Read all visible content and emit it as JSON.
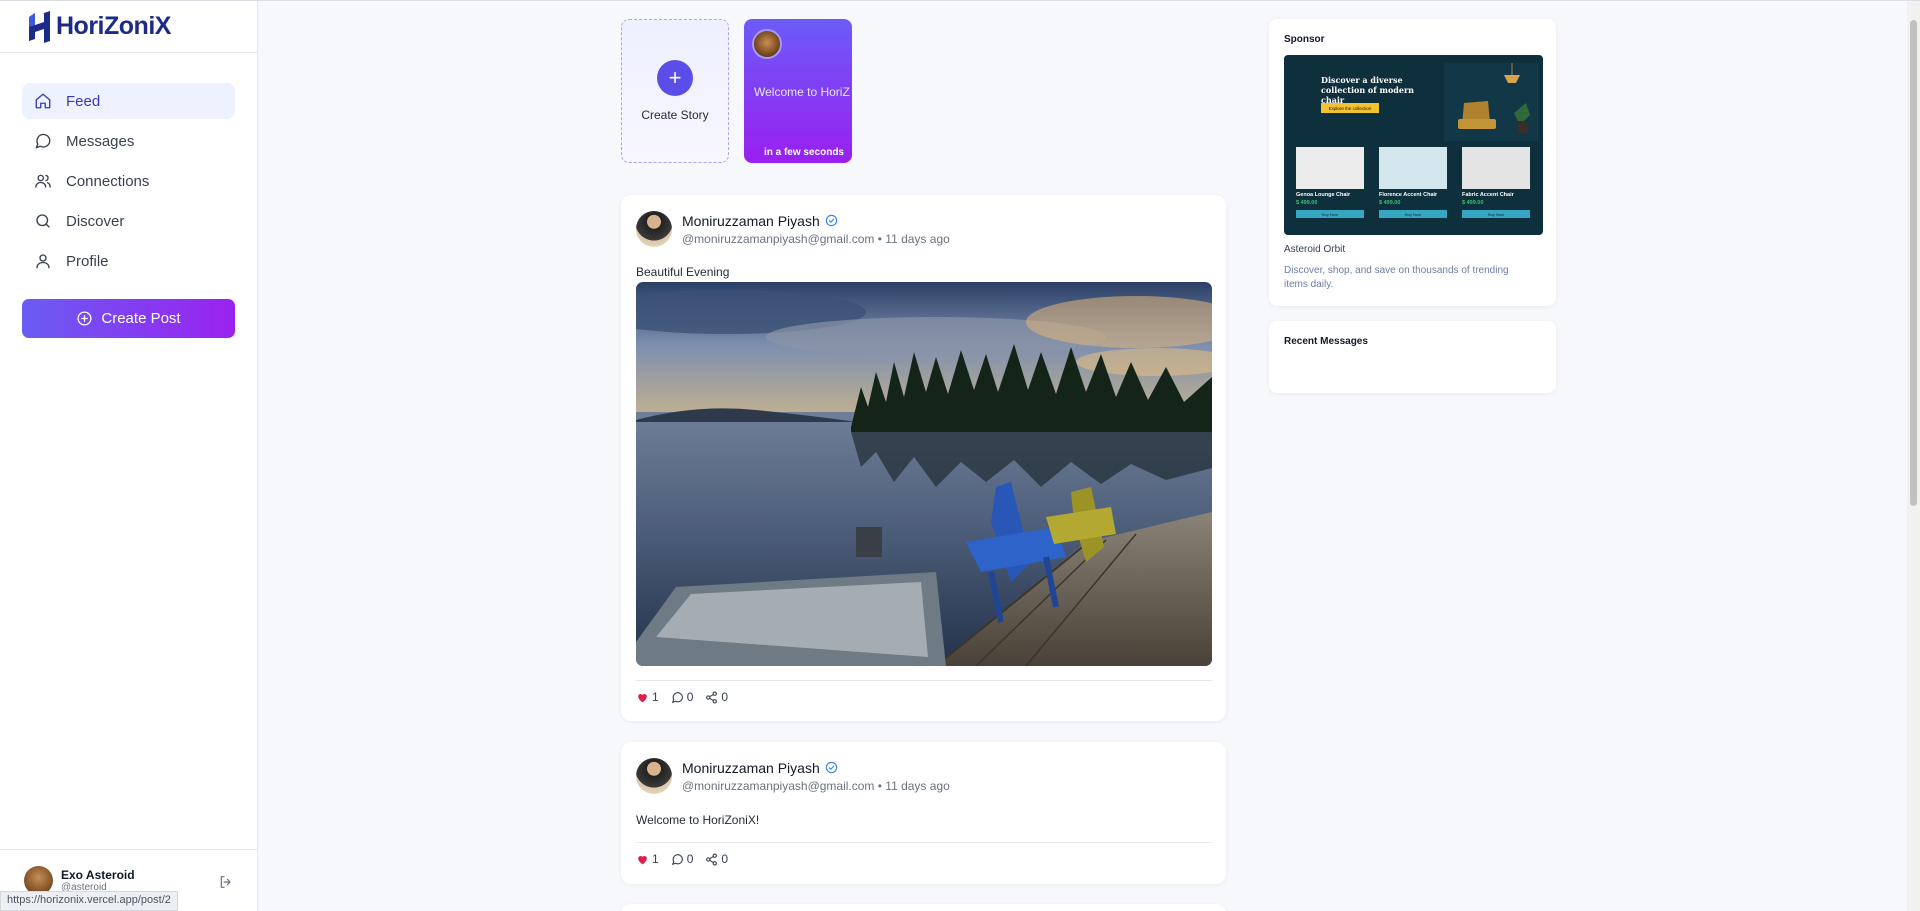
{
  "app": {
    "name": "HoriZoniX"
  },
  "sidebar": {
    "items": [
      {
        "label": "Feed",
        "icon": "home-icon",
        "active": true
      },
      {
        "label": "Messages",
        "icon": "message-icon"
      },
      {
        "label": "Connections",
        "icon": "users-icon"
      },
      {
        "label": "Discover",
        "icon": "search-icon"
      },
      {
        "label": "Profile",
        "icon": "user-icon"
      }
    ],
    "create_post_label": "Create Post",
    "user": {
      "name": "Exo Asteroid",
      "handle": "@asteroid"
    }
  },
  "status_url": "https://horizonix.vercel.app/post/2",
  "stories": {
    "create_label": "Create Story",
    "items": [
      {
        "text": "Welcome to HoriZ",
        "time": "in a few seconds"
      }
    ]
  },
  "posts": [
    {
      "author": "Moniruzzaman Piyash",
      "meta": "@moniruzzamanpiyash@gmail.com • 11 days ago",
      "text": "Beautiful Evening",
      "likes": "1",
      "comments": "0",
      "shares": "0"
    },
    {
      "author": "Moniruzzaman Piyash",
      "meta": "@moniruzzamanpiyash@gmail.com • 11 days ago",
      "text": "Welcome to HoriZoniX!",
      "likes": "1",
      "comments": "0",
      "shares": "0"
    }
  ],
  "sponsor": {
    "title": "Sponsor",
    "ad_headline": "Discover a diverse collection of modern chair",
    "ad_cta": "Explore the collection",
    "products": [
      {
        "name": "Genoa Lounge Chair",
        "price": "$ 499.00",
        "button": "Buy Now"
      },
      {
        "name": "Florence Accent Chair",
        "price": "$ 499.00",
        "button": "Buy Now"
      },
      {
        "name": "Fabric Accent Chair",
        "price": "$ 499.00",
        "button": "Buy Now"
      }
    ],
    "name": "Asteroid Orbit",
    "description": "Discover, shop, and save on thousands of trending items daily."
  },
  "recent_messages": {
    "title": "Recent Messages"
  },
  "colors": {
    "brand": "#1e2a8a",
    "accent": "#6a5cf3",
    "accent2": "#9a22ef",
    "like": "#e11d48",
    "verified": "#3b82f6"
  }
}
